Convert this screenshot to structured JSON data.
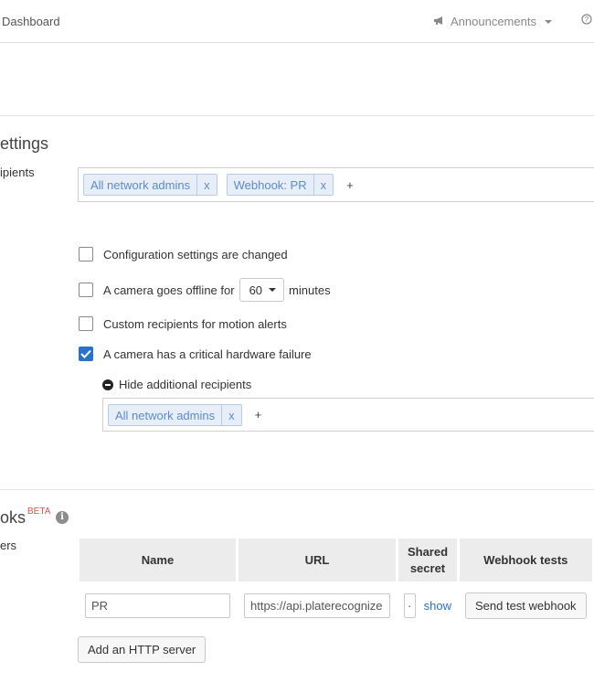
{
  "header": {
    "dashboard": "Dashboard",
    "announcements": "Announcements",
    "help": "?"
  },
  "alerts": {
    "title": "ettings",
    "recipients_label": "ipients",
    "recipients": [
      {
        "label": "All network admins",
        "remove": "x"
      },
      {
        "label": "Webhook: PR",
        "remove": "x"
      }
    ],
    "add": "+",
    "options": [
      {
        "label": "Configuration settings are changed",
        "checked": false
      },
      {
        "label_before": "A camera goes offline for",
        "select_value": "60",
        "label_after": "minutes",
        "checked": false
      },
      {
        "label": "Custom recipients for motion alerts",
        "checked": false
      },
      {
        "label": "A camera has a critical hardware failure",
        "checked": true
      }
    ],
    "hide_additional": "Hide additional recipients",
    "additional_recipients": [
      {
        "label": "All network admins",
        "remove": "x"
      }
    ],
    "additional_add": "+"
  },
  "webhooks": {
    "title": "oks",
    "beta": "BETA",
    "info_icon": "i",
    "servers_label": "ers",
    "columns": [
      "Name",
      "URL",
      "Shared secret",
      "Webhook tests"
    ],
    "rows": [
      {
        "name": "PR",
        "url": "https://api.platerecognize",
        "secret_mask": "·",
        "show": "show",
        "test_button": "Send test webhook"
      }
    ],
    "add_button": "Add an HTTP server"
  },
  "icons": {
    "megaphone": "megaphone-icon",
    "help": "help-circle-icon",
    "info": "info-icon",
    "check": "check-icon",
    "collapse": "minus-circle-icon"
  },
  "colors": {
    "accent": "#2a72c9",
    "token_bg": "#e7eef8",
    "token_text": "#5b8bd0",
    "beta": "#d9534f"
  }
}
